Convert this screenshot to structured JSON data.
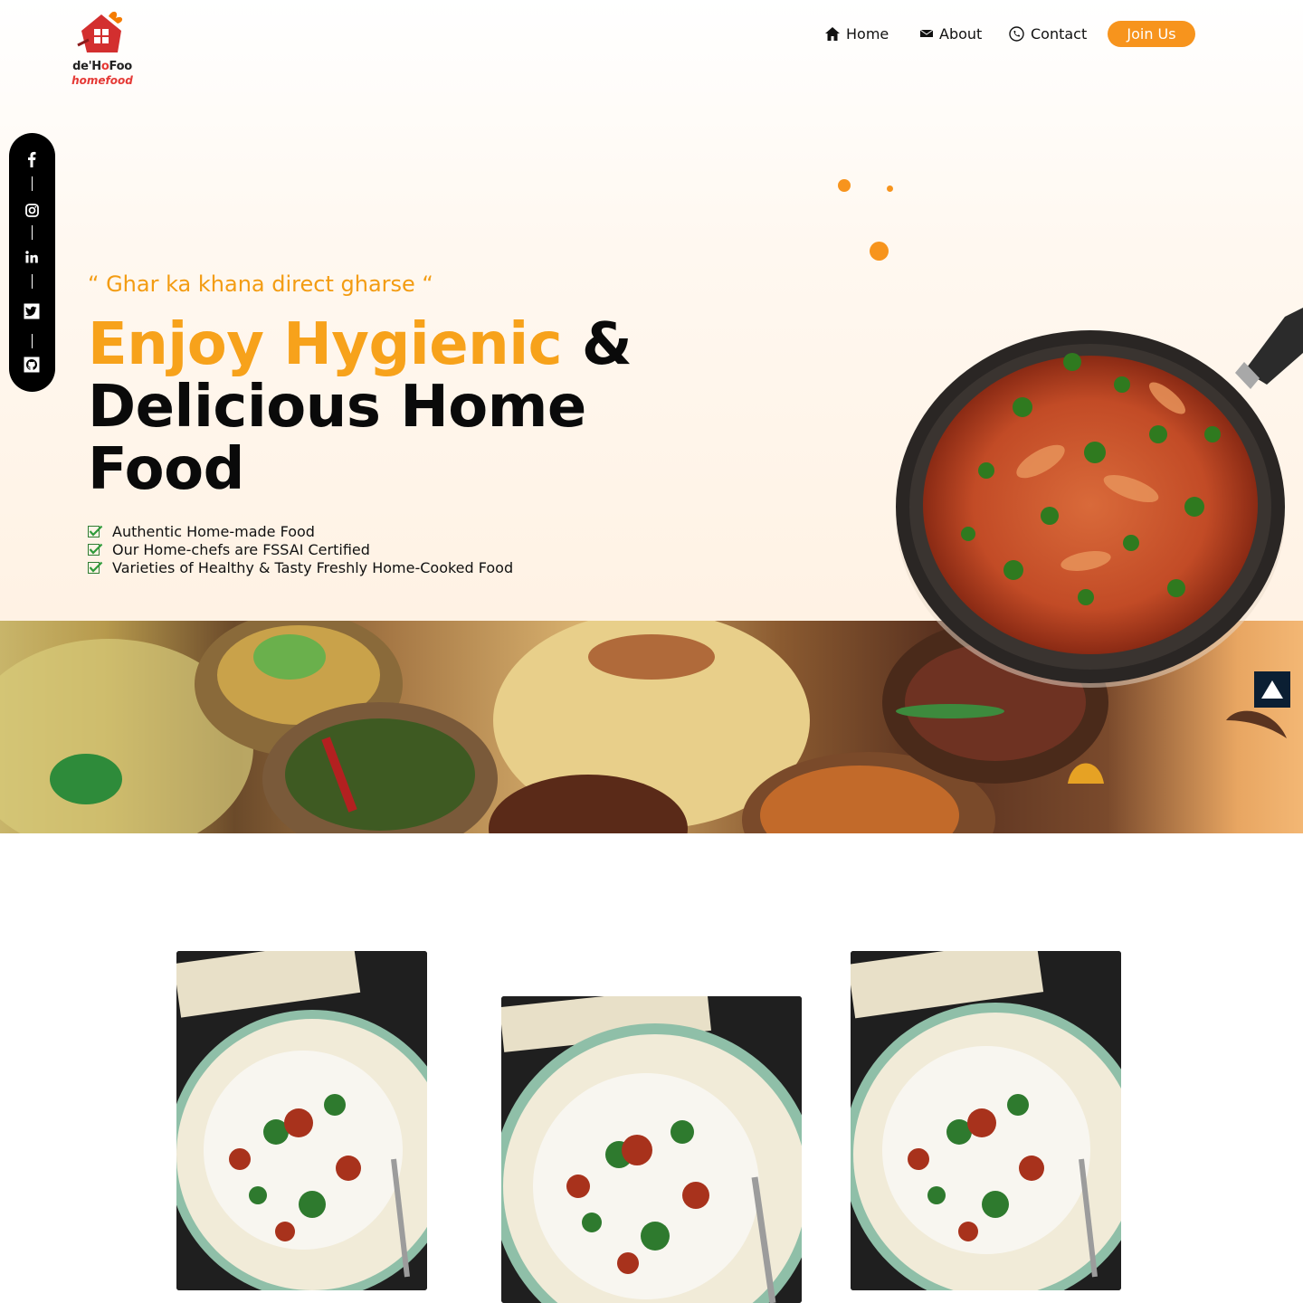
{
  "brand": {
    "name_part1": "de'H",
    "name_o": "o",
    "name_part2": "Foo",
    "tagline": "homefood"
  },
  "nav": {
    "home": "Home",
    "about": "About",
    "contact": "Contact",
    "join": "Join Us"
  },
  "social": [
    "facebook-icon",
    "instagram-icon",
    "linkedin-icon",
    "twitter-icon",
    "github-icon"
  ],
  "hero": {
    "quote": "“ Ghar ka khana direct gharse “",
    "headline_accent": "Enjoy Hygienic",
    "headline_amp": " &",
    "headline_line2": "Delicious Home",
    "headline_line3": "Food",
    "features": [
      "Authentic Home-made Food",
      "Our Home-chefs are FSSAI Certified",
      "Varieties of Healthy & Tasty Freshly Home-Cooked Food"
    ]
  },
  "colors": {
    "accent": "#f7941d",
    "headline_accent": "#f7a21b",
    "dark": "#0a0a0a",
    "scroll_button": "#0b1f33"
  }
}
